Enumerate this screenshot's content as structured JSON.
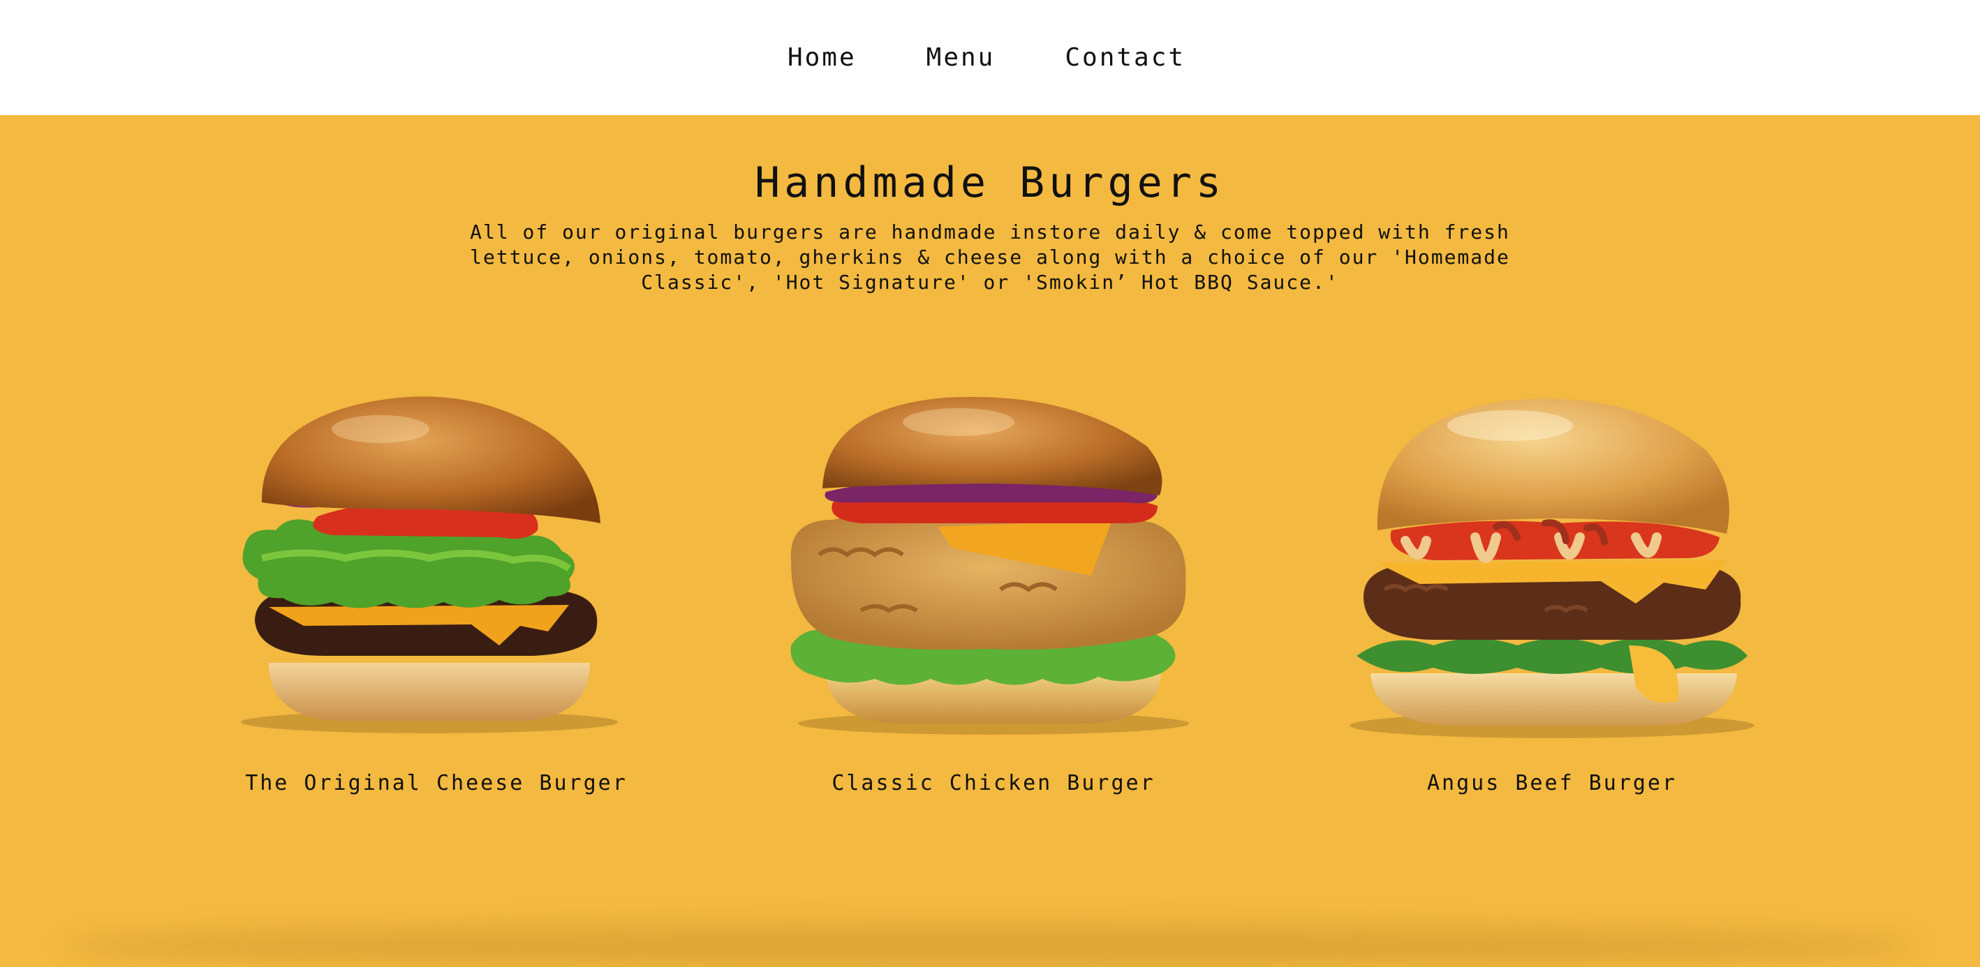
{
  "nav": {
    "items": [
      {
        "label": "Home"
      },
      {
        "label": "Menu"
      },
      {
        "label": "Contact"
      }
    ]
  },
  "hero": {
    "title": "Handmade Burgers",
    "description": "All of our original burgers are handmade instore daily & come topped with fresh lettuce, onions, tomato, gherkins & cheese along with a choice of our 'Homemade Classic', 'Hot Signature' or 'Smokin’ Hot BBQ Sauce.'"
  },
  "burgers": [
    {
      "name": "The Original Cheese Burger",
      "image": "cheese-burger-photo"
    },
    {
      "name": "Classic Chicken Burger",
      "image": "chicken-burger-photo"
    },
    {
      "name": "Angus Beef Burger",
      "image": "beef-burger-photo"
    }
  ],
  "colors": {
    "background": "#f3b940",
    "nav_background": "#ffffff",
    "text": "#111111"
  }
}
